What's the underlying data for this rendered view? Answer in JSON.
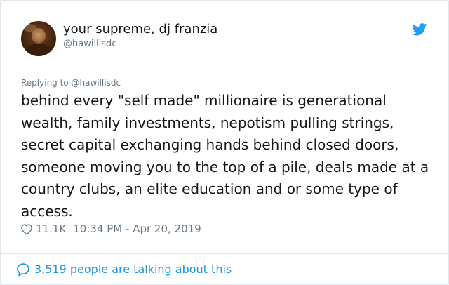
{
  "tweet": {
    "display_name": "your supreme, dj franzia",
    "handle": "@hawillisdc",
    "replying_prefix": "Replying to",
    "replying_to": "@hawillisdc",
    "text": "behind every \"self made\" millionaire is generational wealth, family investments, nepotism pulling strings, secret capital exchanging hands behind closed doors, someone moving you to the top of a pile, deals made at a country clubs, an elite education and or some type of access.",
    "likes": "11.1K",
    "timestamp": "10:34 PM - Apr 20, 2019",
    "talking": "3,519 people are talking about this"
  },
  "icons": {
    "brand": "twitter-bird-icon",
    "like": "heart-outline-icon",
    "reply_count": "speech-bubble-icon"
  },
  "colors": {
    "twitter_blue": "#1da1f2",
    "link_blue": "#1b95e0",
    "muted_text": "#657786",
    "primary_text": "#14171a"
  }
}
